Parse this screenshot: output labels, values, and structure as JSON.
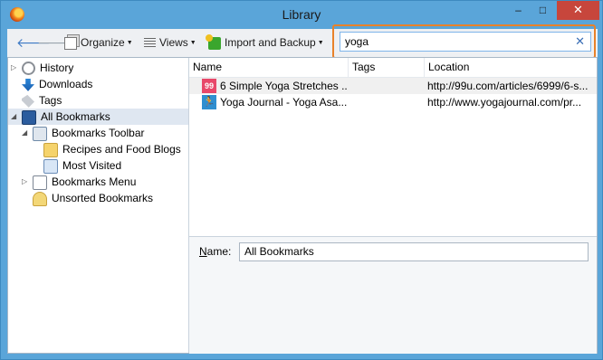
{
  "window": {
    "title": "Library",
    "controls": {
      "minimize": "–",
      "maximize": "□",
      "close": "✕"
    }
  },
  "toolbar": {
    "back": "🡐",
    "forward": "🡒",
    "organize": "Organize",
    "views": "Views",
    "import_backup": "Import and Backup"
  },
  "search": {
    "value": "yoga",
    "clear": "✕",
    "highlight_color": "#e8822a"
  },
  "sidebar": {
    "items": [
      {
        "label": "History",
        "icon": "history-icon"
      },
      {
        "label": "Downloads",
        "icon": "downloads-icon"
      },
      {
        "label": "Tags",
        "icon": "tags-icon"
      },
      {
        "label": "All Bookmarks",
        "icon": "all-bookmarks-icon",
        "selected": true
      },
      {
        "label": "Bookmarks Toolbar",
        "icon": "bookmarks-toolbar-icon"
      },
      {
        "label": "Recipes and Food Blogs",
        "icon": "folder-icon"
      },
      {
        "label": "Most Visited",
        "icon": "most-visited-icon"
      },
      {
        "label": "Bookmarks Menu",
        "icon": "bookmarks-menu-icon"
      },
      {
        "label": "Unsorted Bookmarks",
        "icon": "unsorted-bookmarks-icon"
      }
    ]
  },
  "table": {
    "columns": [
      "Name",
      "Tags",
      "Location"
    ],
    "rows": [
      {
        "favicon": "99",
        "name": "6 Simple Yoga Stretches ...",
        "tags": "",
        "location": "http://99u.com/articles/6999/6-s..."
      },
      {
        "favicon": "🏃",
        "name": "Yoga Journal - Yoga Asa...",
        "tags": "",
        "location": "http://www.yogajournal.com/pr..."
      }
    ]
  },
  "details": {
    "name_label_underlined": "N",
    "name_label_rest": "ame:",
    "name_value": "All Bookmarks"
  },
  "colors": {
    "window_frame": "#5aa5d9",
    "close_button": "#c7463c",
    "selection": "#dfe7f1"
  }
}
